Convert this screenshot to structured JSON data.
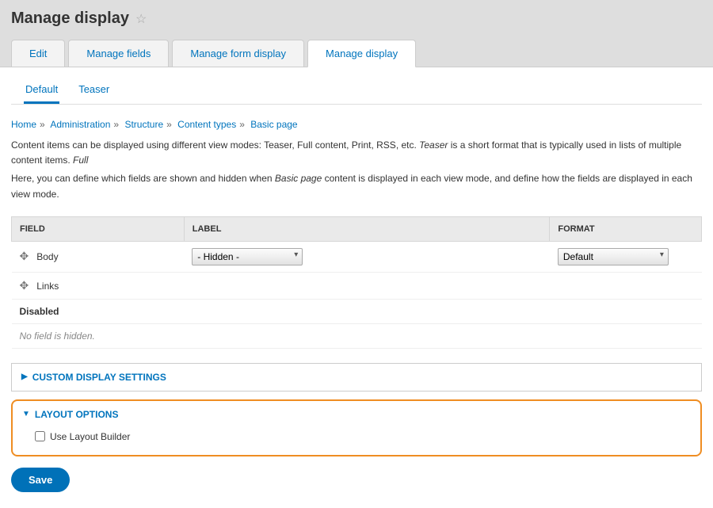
{
  "page_title": "Manage display",
  "tabs_primary": {
    "edit": "Edit",
    "manage_fields": "Manage fields",
    "manage_form": "Manage form display",
    "manage_display": "Manage display"
  },
  "tabs_secondary": {
    "default": "Default",
    "teaser": "Teaser"
  },
  "breadcrumb": {
    "home": "Home",
    "admin": "Administration",
    "structure": "Structure",
    "content_types": "Content types",
    "basic_page": "Basic page"
  },
  "description": {
    "p1a": "Content items can be displayed using different view modes: Teaser, Full content, Print, RSS, etc. ",
    "p1_em1": "Teaser",
    "p1b": " is a short format that is typically used in lists of multiple content items. ",
    "p1_em2": "Full",
    "p2a": "Here, you can define which fields are shown and hidden when ",
    "p2_em": "Basic page",
    "p2b": " content is displayed in each view mode, and define how the fields are displayed in each view mode."
  },
  "table": {
    "head_field": "FIELD",
    "head_label": "LABEL",
    "head_format": "FORMAT",
    "body_label": "Body",
    "links_label": "Links",
    "select_hidden": "- Hidden -",
    "select_default": "Default",
    "disabled_heading": "Disabled",
    "no_hidden": "No field is hidden."
  },
  "details": {
    "custom_display": "CUSTOM DISPLAY SETTINGS",
    "layout_options": "LAYOUT OPTIONS",
    "use_layout_builder": "Use Layout Builder"
  },
  "save_label": "Save"
}
